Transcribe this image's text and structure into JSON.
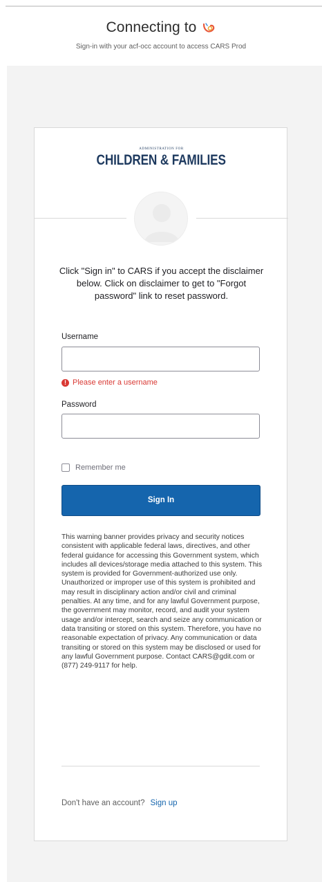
{
  "header": {
    "title": "Connecting to",
    "subtitle": "Sign-in with your acf-occ account to access CARS Prod"
  },
  "org_logo": {
    "admin_line": "Administration for",
    "name": "CHILDREN & FAMILIES",
    "color": "#1e3a5f"
  },
  "form": {
    "heading": "Click \"Sign in\" to CARS if you accept the disclaimer below. Click on disclaimer to get to \"Forgot password\" link to reset password.",
    "username_label": "Username",
    "username_value": "",
    "username_error": "Please enter a username",
    "password_label": "Password",
    "password_value": "",
    "remember_label": "Remember me",
    "remember_checked": false,
    "submit_label": "Sign In",
    "warning": "This warning banner provides privacy and security notices consistent with applicable federal laws, directives, and other federal guidance for accessing this Government system, which includes all devices/storage media attached to this system. This system is provided for Government-authorized use only. Unauthorized or improper use of this system is prohibited and may result in disciplinary action and/or civil and criminal penalties. At any time, and for any lawful Government purpose, the government may monitor, record, and audit your system usage and/or intercept, search and seize any communication or data transiting or stored on this system. Therefore, you have no reasonable expectation of privacy. Any communication or data transiting or stored on this system may be disclosed or used for any lawful Government purpose. Contact CARS@gdit.com or (877) 249-9117 for help.",
    "signup_question": "Don't have an account?",
    "signup_link": "Sign up"
  },
  "colors": {
    "primary": "#1565ad",
    "error": "#d93934",
    "background": "#f3f3f3"
  },
  "icons": {
    "header_logo": "occ-logo-icon",
    "avatar": "user-avatar-icon",
    "error": "error-icon"
  }
}
